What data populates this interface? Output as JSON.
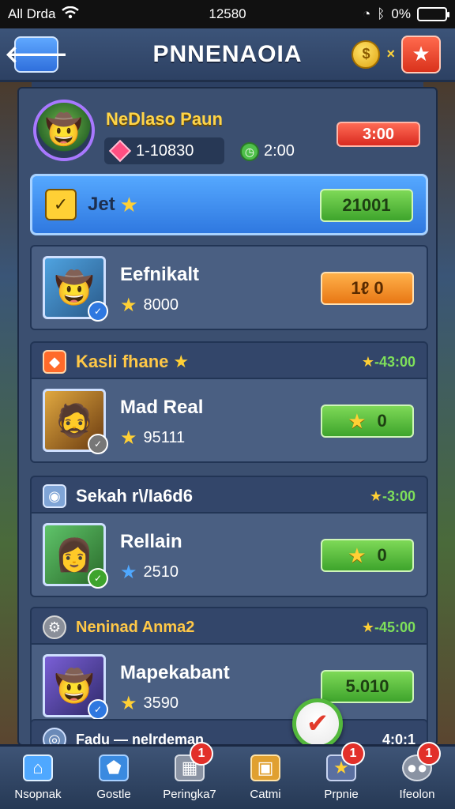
{
  "statusbar": {
    "carrier": "All Drda",
    "time": "12580",
    "battery": "0%"
  },
  "header": {
    "title": "PNNENAOIA",
    "multiplier": "×"
  },
  "profile": {
    "name": "NeDlaso Paun",
    "gems": "1-10830",
    "time": "2:00",
    "badge": "3:00"
  },
  "jet": {
    "label": "Jet",
    "value": "21001"
  },
  "cards": [
    {
      "name": "Eefnikalt",
      "score": "8000",
      "button": "1ℓ 0",
      "button_style": "orange"
    },
    {
      "name": "Mad Real",
      "score": "95111",
      "button": "0",
      "button_style": "green"
    },
    {
      "name": "Rellain",
      "score": "2510",
      "button": "0",
      "button_style": "green"
    },
    {
      "name": "Mapekabant",
      "score": "3590",
      "button": "5.010",
      "button_style": "green"
    }
  ],
  "sections": [
    {
      "label": "Kasli fhane",
      "right": "-43:00"
    },
    {
      "label": "Sekah r\\/Ia6d6",
      "right": "-3:00"
    },
    {
      "label": "Neninad Anma2",
      "right": "-45:00"
    },
    {
      "label": "Fadu — nelrdeman",
      "right": "4:0:1"
    }
  ],
  "nav": [
    {
      "label": "Nsopnak",
      "icon": "home-icon",
      "badge": ""
    },
    {
      "label": "Gostle",
      "icon": "shield-icon",
      "badge": ""
    },
    {
      "label": "Peringka7",
      "icon": "box-icon",
      "badge": "1"
    },
    {
      "label": "Catmi",
      "icon": "chest-icon",
      "badge": ""
    },
    {
      "label": "Prpnie",
      "icon": "star-icon",
      "badge": "1"
    },
    {
      "label": "Ifeolon",
      "icon": "chat-icon",
      "badge": "1"
    }
  ],
  "colors": {
    "accent": "#2f78e0",
    "green": "#3ea42c",
    "orange": "#e87714",
    "gold": "#ffd035"
  }
}
